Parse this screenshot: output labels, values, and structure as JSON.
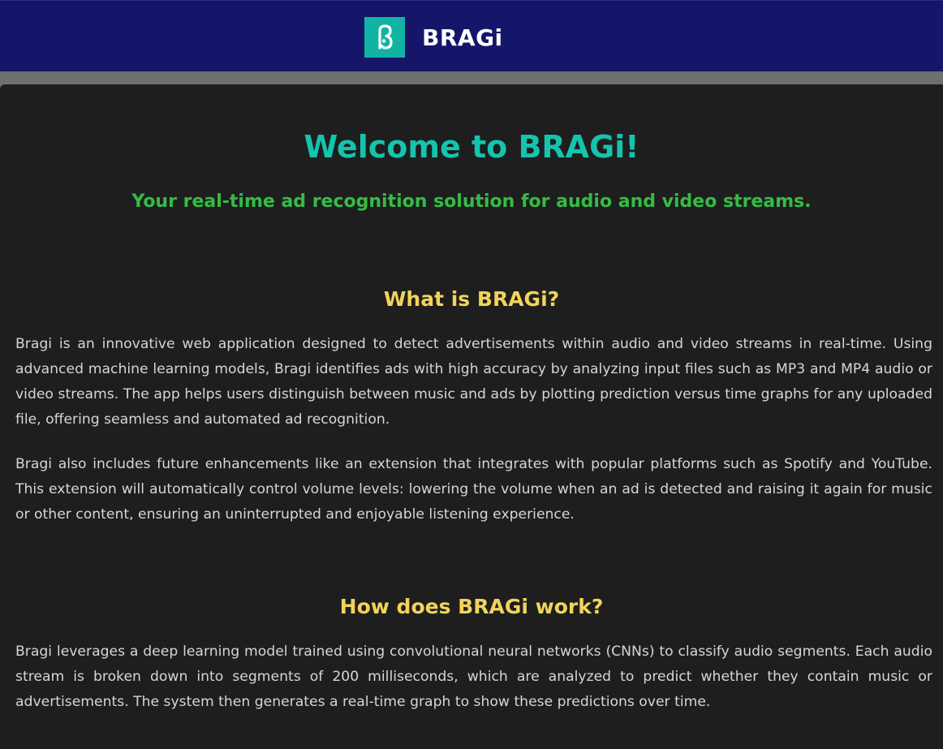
{
  "header": {
    "logo_glyph": "ß",
    "brand": "BRAGi",
    "colors": {
      "bar": "#15166a",
      "logo": "#13b3a4"
    },
    "logo_icon": "bragi-logo-icon"
  },
  "hero": {
    "title": "Welcome to BRAGi!",
    "tagline": "Your real-time ad recognition solution for audio and video streams."
  },
  "sections": [
    {
      "title": "What is BRAGi?",
      "paragraphs": [
        "Bragi is an innovative web application designed to detect advertisements within audio and video streams in real-time. Using advanced machine learning models, Bragi identifies ads with high accuracy by analyzing input files such as MP3 and MP4 audio or video streams. The app helps users distinguish between music and ads by plotting prediction versus time graphs for any uploaded file, offering seamless and automated ad recognition.",
        "Bragi also includes future enhancements like an extension that integrates with popular platforms such as Spotify and YouTube. This extension will automatically control volume levels: lowering the volume when an ad is detected and raising it again for music or other content, ensuring an uninterrupted and enjoyable listening experience."
      ]
    },
    {
      "title": "How does BRAGi work?",
      "paragraphs": [
        "Bragi leverages a deep learning model trained using convolutional neural networks (CNNs) to classify audio segments. Each audio stream is broken down into segments of 200 milliseconds, which are analyzed to predict whether they contain music or advertisements. The system then generates a real-time graph to show these predictions over time."
      ]
    }
  ],
  "colors": {
    "title": "#14c4ad",
    "tagline": "#35bc45",
    "section_title": "#f2d35b",
    "body_text": "#d6d6d6",
    "background": "#1e1e1e"
  }
}
